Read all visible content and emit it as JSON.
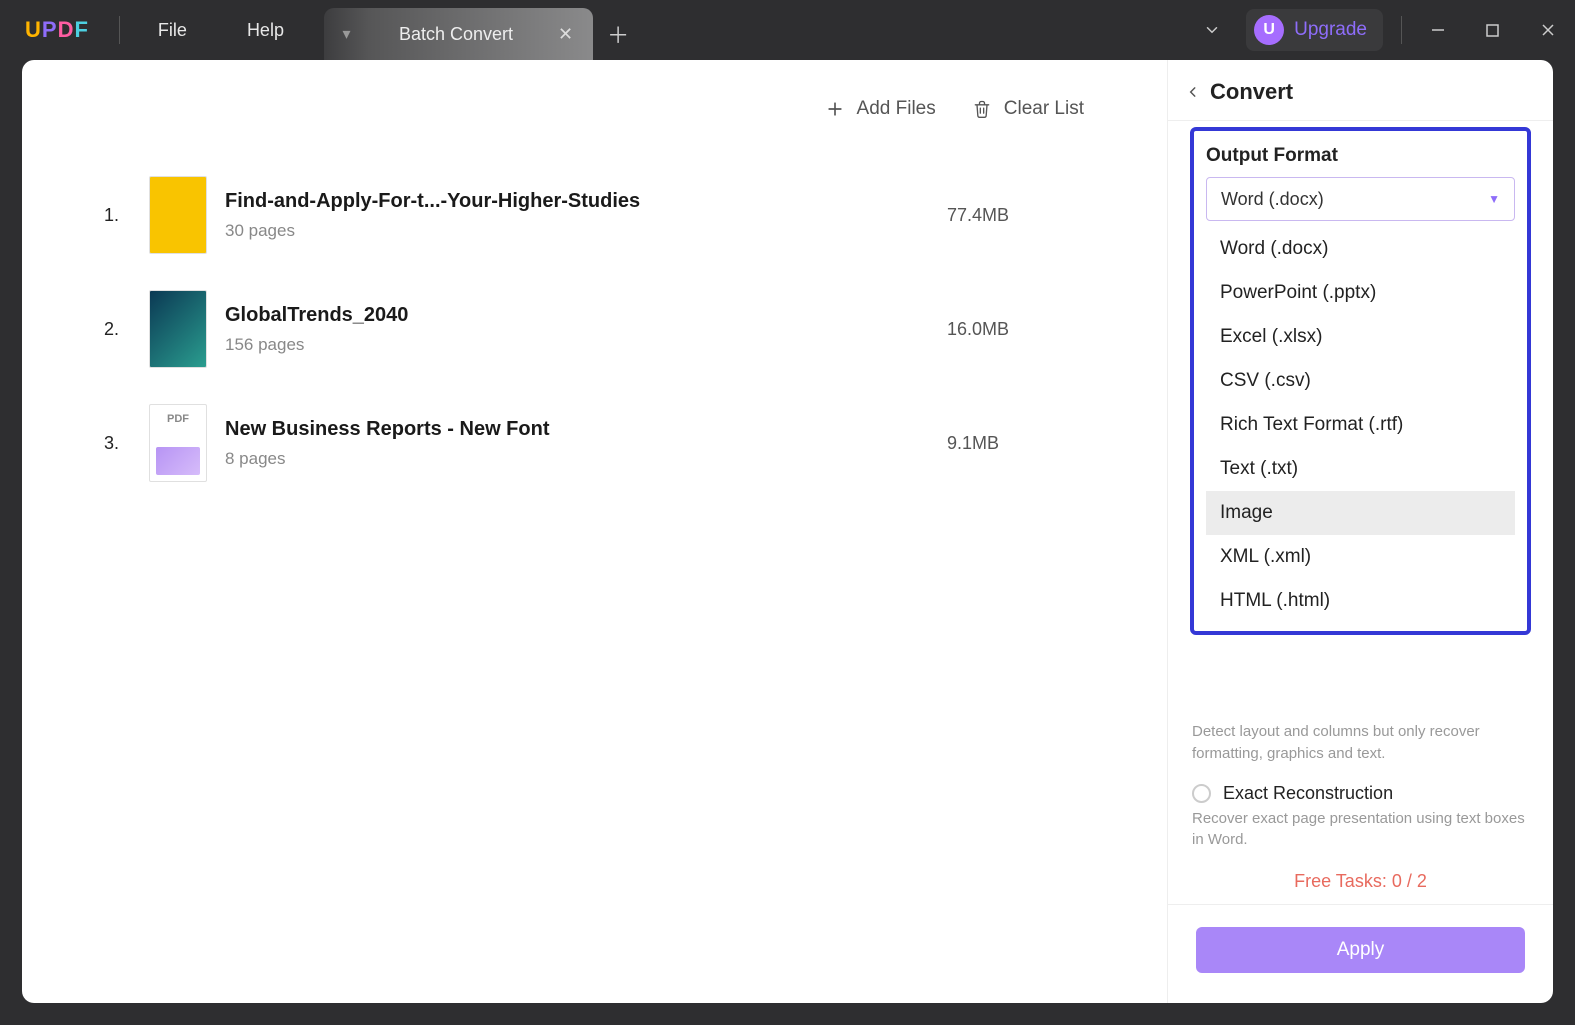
{
  "app": {
    "logo_letters": [
      "U",
      "P",
      "D",
      "F"
    ]
  },
  "menu": {
    "file": "File",
    "help": "Help"
  },
  "tab": {
    "title": "Batch Convert"
  },
  "upgrade": {
    "badge": "U",
    "label": "Upgrade"
  },
  "toolbar": {
    "add_files": "Add Files",
    "clear_list": "Clear List"
  },
  "files": [
    {
      "num": "1.",
      "name": "Find-and-Apply-For-t...-Your-Higher-Studies",
      "pages": "30 pages",
      "size": "77.4MB",
      "thumb": "yellow"
    },
    {
      "num": "2.",
      "name": "GlobalTrends_2040",
      "pages": "156 pages",
      "size": "16.0MB",
      "thumb": "teal"
    },
    {
      "num": "3.",
      "name": "New Business Reports - New Font",
      "pages": "8 pages",
      "size": "9.1MB",
      "thumb": "pdf"
    }
  ],
  "side": {
    "title": "Convert",
    "output_format_label": "Output Format",
    "selected_format": "Word (.docx)",
    "formats": [
      "Word (.docx)",
      "PowerPoint (.pptx)",
      "Excel (.xlsx)",
      "CSV (.csv)",
      "Rich Text Format (.rtf)",
      "Text (.txt)",
      "Image",
      "XML (.xml)",
      "HTML (.html)"
    ],
    "hover_index": 6,
    "opt1_desc": "Detect layout and columns but only recover formatting, graphics and text.",
    "opt2_label": "Exact Reconstruction",
    "opt2_desc": "Recover exact page presentation using text boxes in Word.",
    "free_tasks": "Free Tasks: 0 / 2",
    "apply": "Apply"
  }
}
